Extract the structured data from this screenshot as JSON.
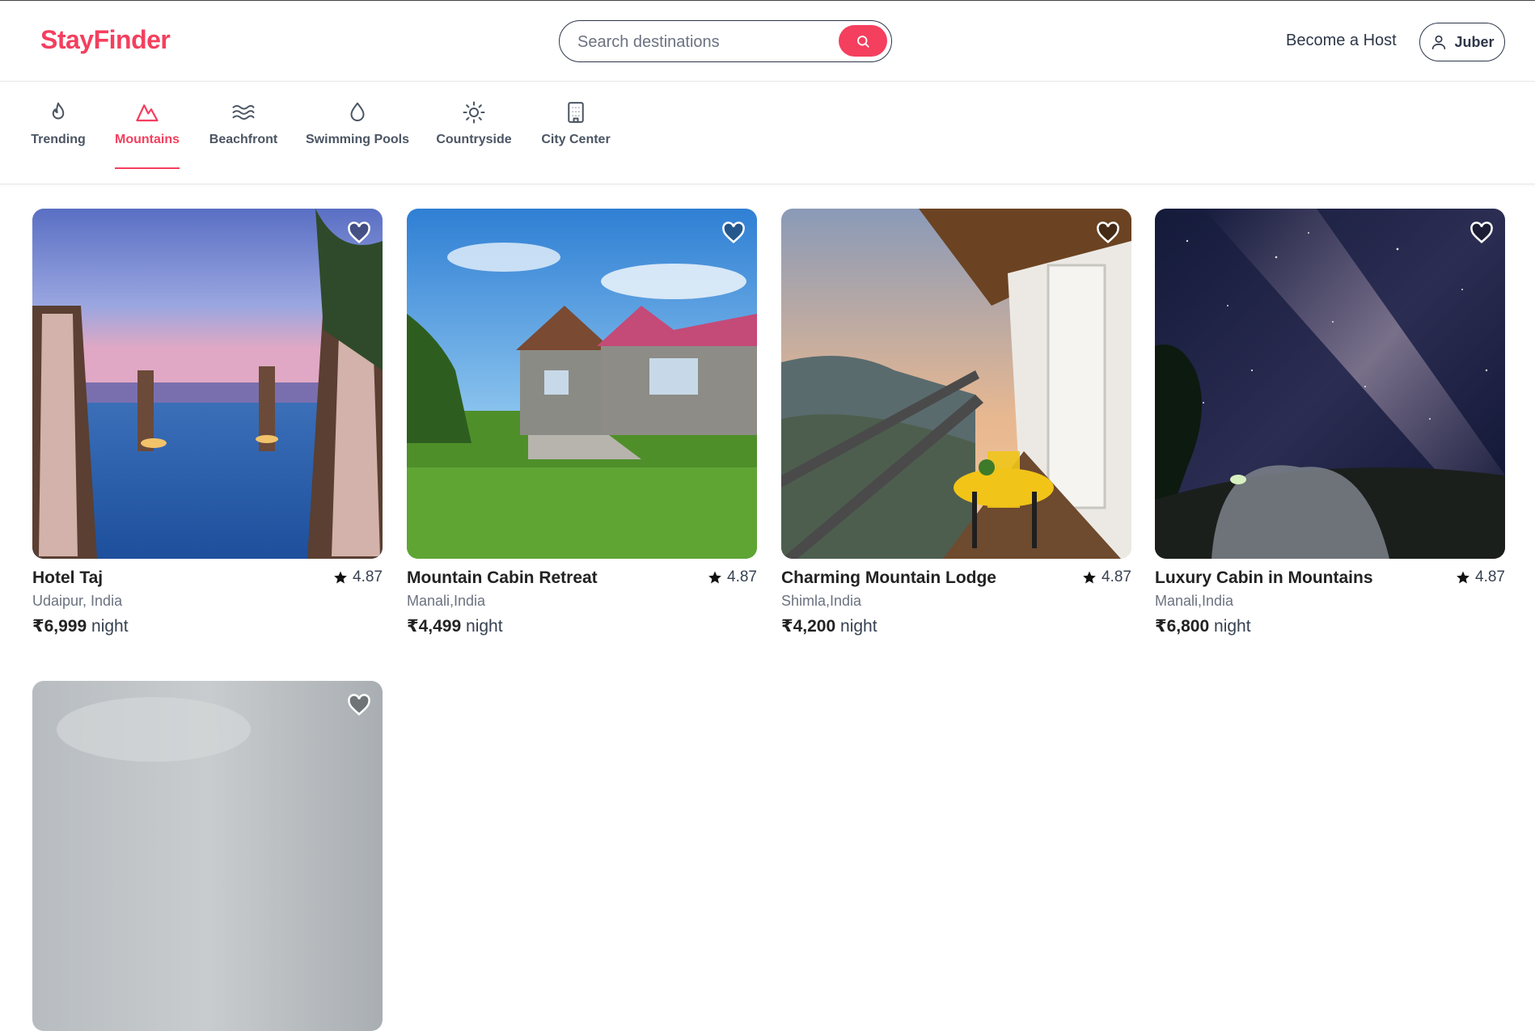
{
  "colors": {
    "brand": "#f43f5e",
    "text": "#222222",
    "muted": "#6b7280"
  },
  "header": {
    "logo": "StayFinder",
    "search": {
      "placeholder": "Search destinations",
      "icon": "search-icon"
    },
    "become_host": "Become a Host",
    "user": {
      "name": "Juber",
      "icon": "user-icon"
    }
  },
  "categories": [
    {
      "label": "Trending",
      "icon": "flame-icon",
      "active": false
    },
    {
      "label": "Mountains",
      "icon": "mountain-icon",
      "active": true
    },
    {
      "label": "Beachfront",
      "icon": "waves-icon",
      "active": false
    },
    {
      "label": "Swimming Pools",
      "icon": "droplet-icon",
      "active": false
    },
    {
      "label": "Countryside",
      "icon": "sun-icon",
      "active": false
    },
    {
      "label": "City Center",
      "icon": "building-icon",
      "active": false
    }
  ],
  "price_unit": "night",
  "listings": [
    {
      "title": "Hotel Taj",
      "location": "Udaipur, India",
      "price": "₹6,999",
      "rating": "4.87",
      "photo": "poolside cabanas at sunset"
    },
    {
      "title": "Mountain Cabin Retreat",
      "location": "Manali,India",
      "price": "₹4,499",
      "rating": "4.87",
      "photo": "stone cabins on green lawn"
    },
    {
      "title": "Charming Mountain Lodge",
      "location": "Shimla,India",
      "price": "₹4,200",
      "rating": "4.87",
      "photo": "balcony with yellow table overlooking hills"
    },
    {
      "title": "Luxury Cabin in Mountains",
      "location": "Manali,India",
      "price": "₹6,800",
      "rating": "4.87",
      "photo": "dome tent under milky way"
    },
    {
      "title": "",
      "location": "",
      "price": "",
      "rating": "",
      "photo": "cloudy sky"
    }
  ]
}
